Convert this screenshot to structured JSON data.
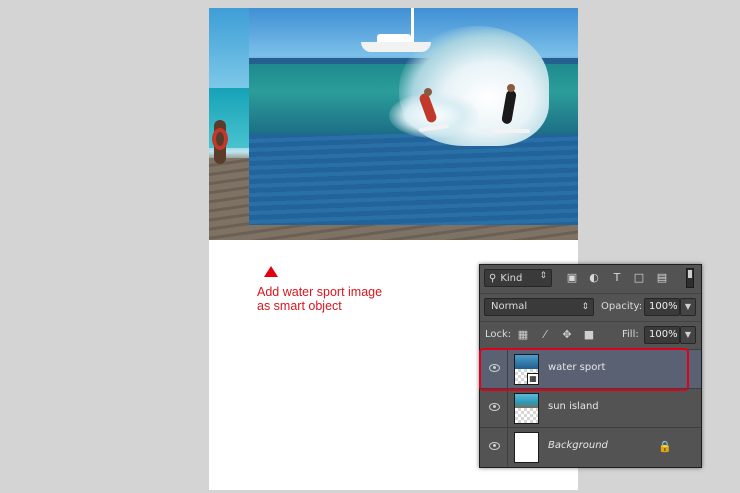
{
  "canvas": {
    "layers_visible": [
      "sun island",
      "water sport"
    ]
  },
  "annotation": {
    "line1": "Add water sport image",
    "line2": "as smart object",
    "color": "#d8161d"
  },
  "layers_panel": {
    "filter": {
      "kind_label": "Kind",
      "search_icon": "search-icon"
    },
    "blend_mode": "Normal",
    "opacity_label": "Opacity:",
    "opacity_value": "100%",
    "lock_label": "Lock:",
    "fill_label": "Fill:",
    "fill_value": "100%",
    "layers": [
      {
        "name": "water sport",
        "selected": true,
        "smart_object": true,
        "highlighted": true
      },
      {
        "name": "sun island",
        "selected": false,
        "smart_object": false
      },
      {
        "name": "Background",
        "selected": false,
        "locked": true
      }
    ],
    "highlight_color": "#e0001b"
  }
}
